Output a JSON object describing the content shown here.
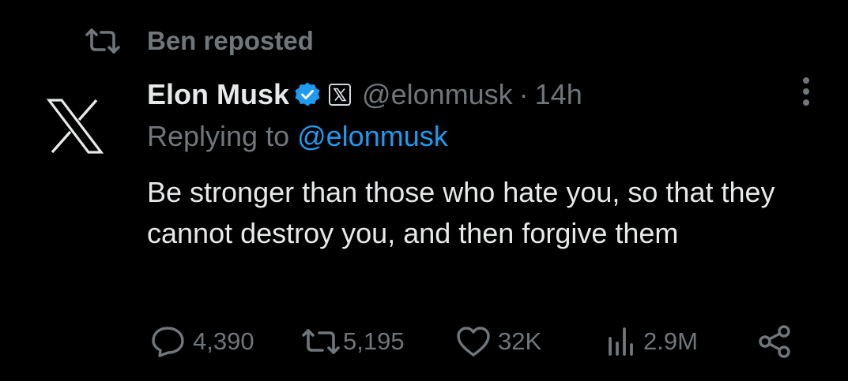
{
  "repost_banner": {
    "icon": "repost-icon",
    "text": "Ben reposted"
  },
  "author": {
    "avatar_icon": "x-logo-icon",
    "display_name": "Elon Musk",
    "verified_icon": "verified-badge-icon",
    "affiliation_icon": "x-affiliate-badge-icon",
    "handle": "@elonmusk",
    "separator": "·",
    "time": "14h"
  },
  "reply_context": {
    "prefix": "Replying to ",
    "mention": "@elonmusk"
  },
  "tweet_text": "Be stronger than those who hate you, so that they cannot destroy you, and then forgive them",
  "actions": {
    "reply": {
      "icon": "reply-icon",
      "count": "4,390"
    },
    "repost": {
      "icon": "repost-icon",
      "count": "5,195"
    },
    "like": {
      "icon": "heart-icon",
      "count": "32K"
    },
    "views": {
      "icon": "analytics-icon",
      "count": "2.9M"
    },
    "share": {
      "icon": "share-icon"
    }
  },
  "more_icon": "more-options-icon",
  "colors": {
    "background": "#000000",
    "primary_text": "#e7e9ea",
    "secondary_text": "#71767b",
    "link": "#1d9bf0",
    "verified": "#1d9bf0"
  }
}
